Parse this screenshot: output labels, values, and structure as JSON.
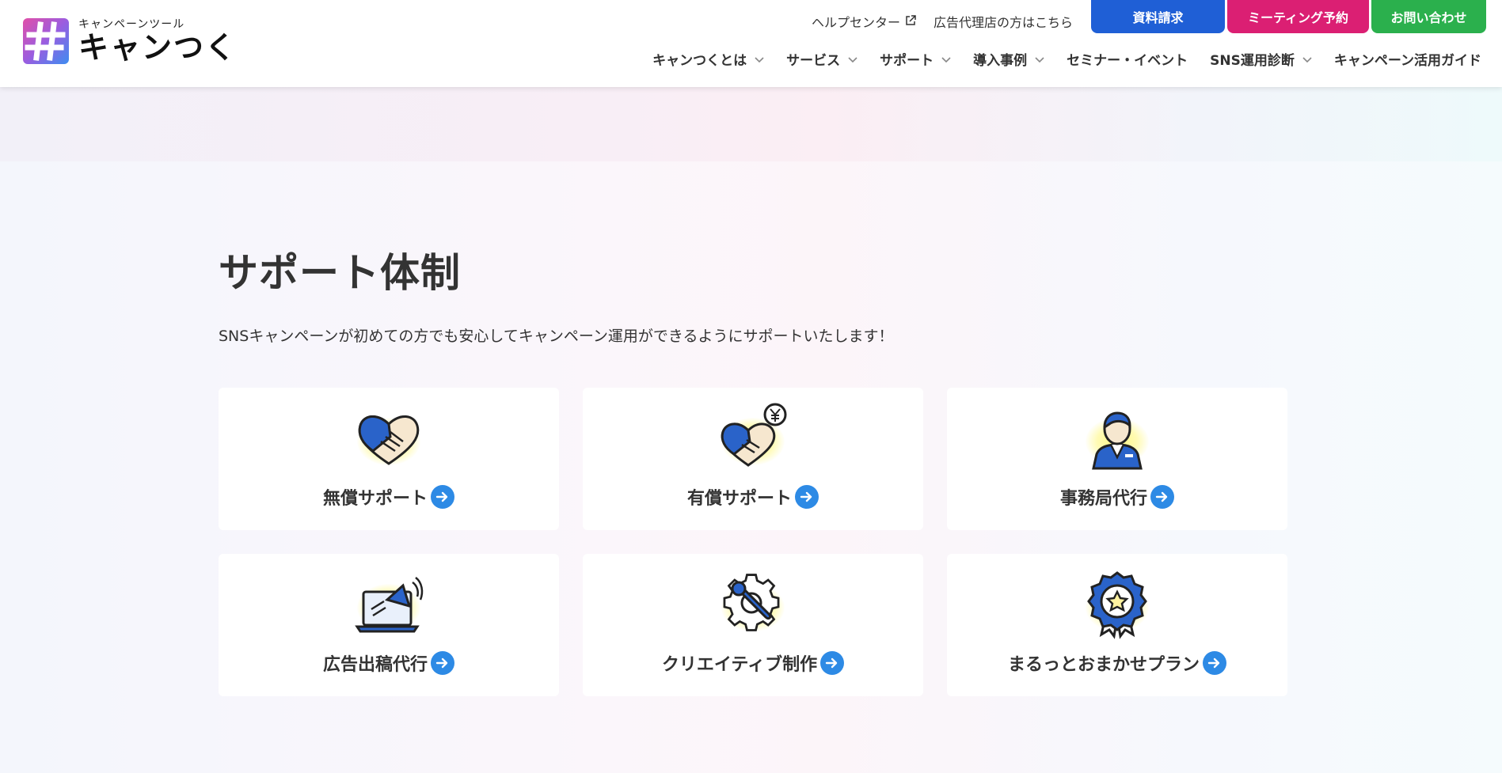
{
  "header": {
    "logo_sub": "キャンペーンツール",
    "logo_main": "キャンつく",
    "help_center": "ヘルプセンター",
    "agency_link": "広告代理店の方はこちら",
    "cta_docs": "資料請求",
    "cta_meeting": "ミーティング予約",
    "cta_contact": "お問い合わせ",
    "colors": {
      "docs": "#1f5fd6",
      "meeting": "#db1f73",
      "contact": "#2bb04d"
    }
  },
  "nav": {
    "items": [
      {
        "label": "キャンつくとは",
        "has_dropdown": true
      },
      {
        "label": "サービス",
        "has_dropdown": true
      },
      {
        "label": "サポート",
        "has_dropdown": true
      },
      {
        "label": "導入事例",
        "has_dropdown": true
      },
      {
        "label": "セミナー・イベント",
        "has_dropdown": false
      },
      {
        "label": "SNS運用診断",
        "has_dropdown": true
      },
      {
        "label": "キャンペーン活用ガイド",
        "has_dropdown": false
      }
    ]
  },
  "section": {
    "title": "サポート体制",
    "description": "SNSキャンペーンが初めての方でも安心してキャンペーン運用ができるようにサポートいたします！",
    "cards": [
      {
        "label": "無償サポート",
        "icon": "handshake-heart-icon"
      },
      {
        "label": "有償サポート",
        "icon": "handshake-yen-icon"
      },
      {
        "label": "事務局代行",
        "icon": "staff-person-icon"
      },
      {
        "label": "広告出稿代行",
        "icon": "laptop-megaphone-icon"
      },
      {
        "label": "クリエイティブ制作",
        "icon": "gear-wrench-icon"
      },
      {
        "label": "まるっとおまかせプラン",
        "icon": "award-badge-icon"
      }
    ],
    "accent_color": "#2d8ae5"
  }
}
